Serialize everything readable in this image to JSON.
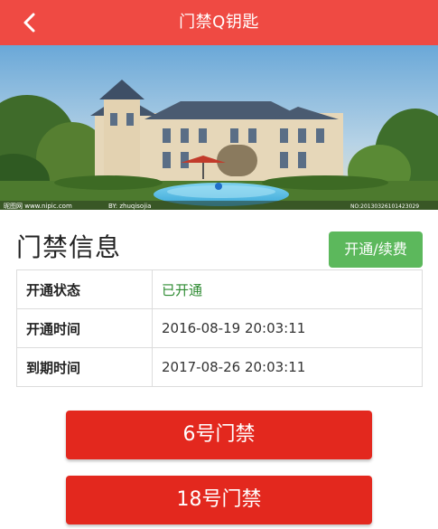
{
  "header": {
    "title": "门禁Q钥匙",
    "back_icon": "chevron-left-icon"
  },
  "hero": {
    "description_free_watermark_left": "昵图网 www.nipic.com",
    "watermark_mid": "BY: zhuqisojia",
    "watermark_right": "NO:20130326101423029"
  },
  "section": {
    "title": "门禁信息",
    "renew_label": "开通/续费"
  },
  "info_rows": [
    {
      "label": "开通状态",
      "value": "已开通",
      "value_color": "#2e8b32"
    },
    {
      "label": "开通时间",
      "value": "2016-08-19 20:03:11"
    },
    {
      "label": "到期时间",
      "value": "2017-08-26 20:03:11"
    }
  ],
  "doors": [
    {
      "label": "6号门禁"
    },
    {
      "label": "18号门禁"
    }
  ],
  "colors": {
    "topbar": "#ef4a43",
    "renew": "#5cb85c",
    "door_button": "#e3281e"
  }
}
